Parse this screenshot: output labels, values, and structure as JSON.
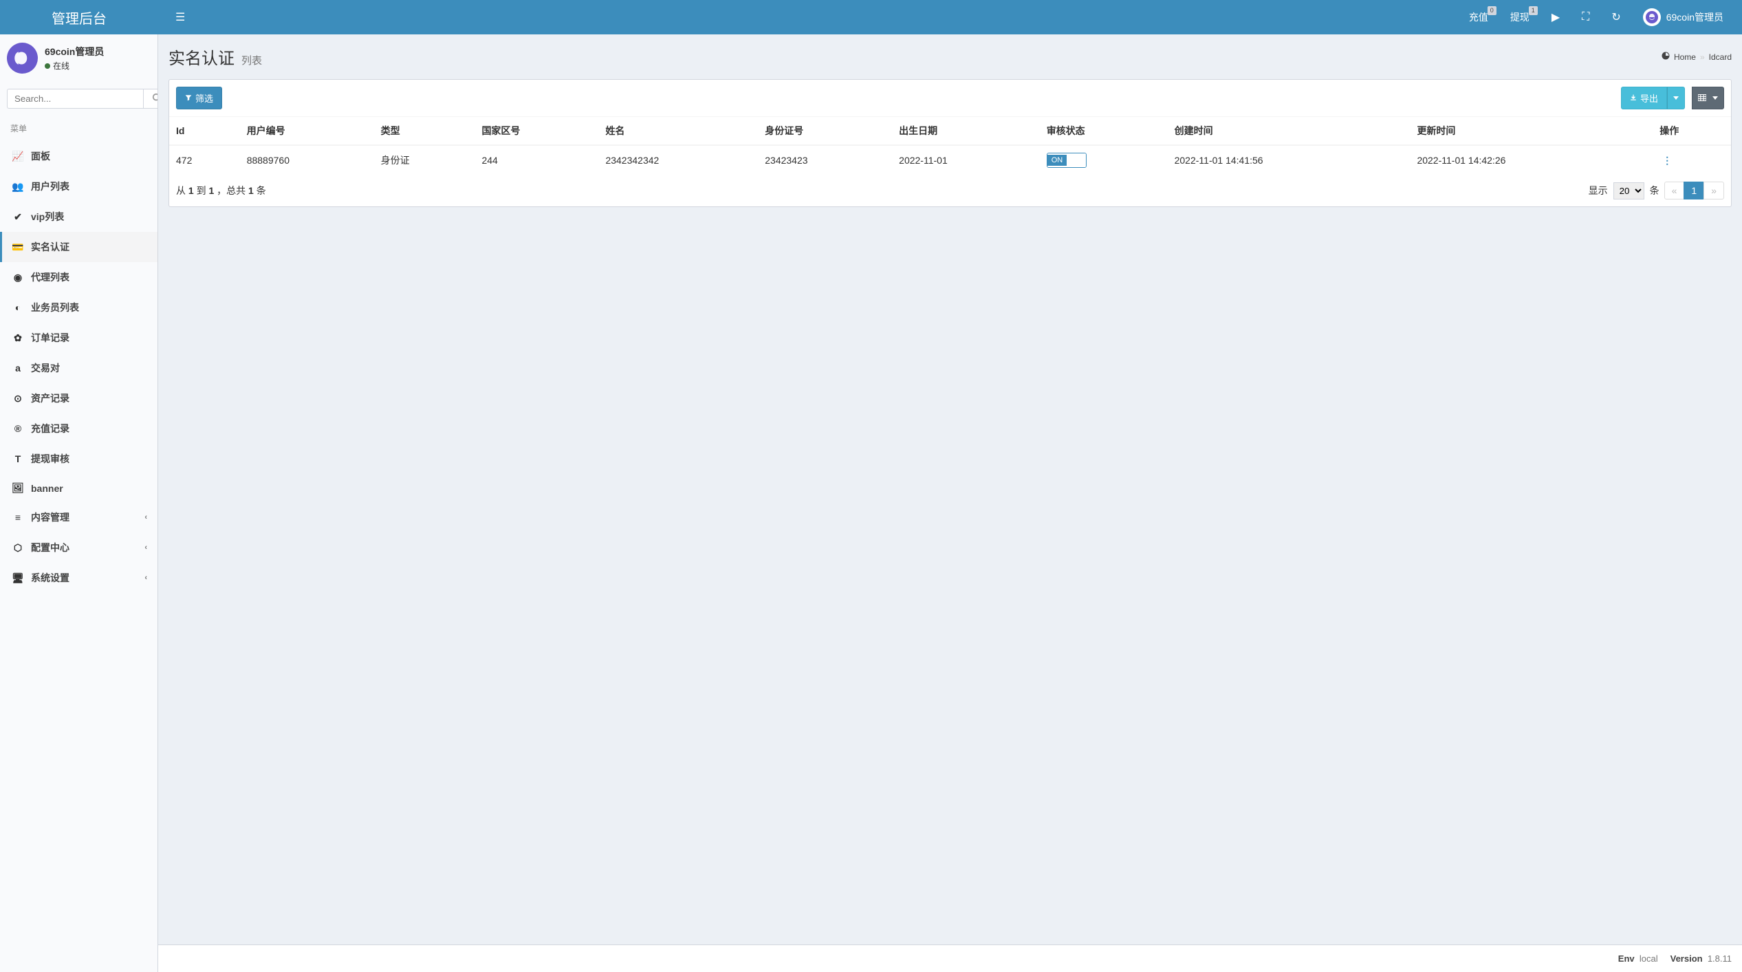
{
  "header": {
    "logo": "管理后台",
    "recharge_label": "充值",
    "recharge_badge": "0",
    "withdraw_label": "提现",
    "withdraw_badge": "1",
    "username": "69coin管理员"
  },
  "sidebar": {
    "user_name": "69coin管理员",
    "user_status": "在线",
    "search_placeholder": "Search...",
    "menu_header": "菜单",
    "items": [
      {
        "icon": "📈",
        "label": "面板",
        "expand": false,
        "active": false
      },
      {
        "icon": "👥",
        "label": "用户列表",
        "expand": false,
        "active": false
      },
      {
        "icon": "✔",
        "label": "vip列表",
        "expand": false,
        "active": false
      },
      {
        "icon": "💳",
        "label": "实名认证",
        "expand": false,
        "active": true
      },
      {
        "icon": "◉",
        "label": "代理列表",
        "expand": false,
        "active": false
      },
      {
        "icon": "◐",
        "label": "业务员列表",
        "expand": false,
        "active": false
      },
      {
        "icon": "✿",
        "label": "订单记录",
        "expand": false,
        "active": false
      },
      {
        "icon": "a",
        "label": "交易对",
        "expand": false,
        "active": false
      },
      {
        "icon": "⊙",
        "label": "资产记录",
        "expand": false,
        "active": false
      },
      {
        "icon": "®",
        "label": "充值记录",
        "expand": false,
        "active": false
      },
      {
        "icon": "T",
        "label": "提现审核",
        "expand": false,
        "active": false
      },
      {
        "icon": "🖼",
        "label": "banner",
        "expand": false,
        "active": false
      },
      {
        "icon": "≡",
        "label": "内容管理",
        "expand": true,
        "active": false
      },
      {
        "icon": "⬡",
        "label": "配置中心",
        "expand": true,
        "active": false
      },
      {
        "icon": "🖥",
        "label": "系统设置",
        "expand": true,
        "active": false
      }
    ]
  },
  "page": {
    "title": "实名认证",
    "subtitle": "列表",
    "breadcrumb_home": "Home",
    "breadcrumb_current": "Idcard"
  },
  "toolbar": {
    "filter_label": "筛选",
    "export_label": "导出"
  },
  "table": {
    "columns": [
      "Id",
      "用户编号",
      "类型",
      "国家区号",
      "姓名",
      "身份证号",
      "出生日期",
      "审核状态",
      "创建时间",
      "更新时间",
      "操作"
    ],
    "rows": [
      {
        "id": "472",
        "user_no": "88889760",
        "type": "身份证",
        "country_code": "244",
        "name": "2342342342",
        "id_number": "23423423",
        "birthdate": "2022-11-01",
        "status_on": "ON",
        "created_at": "2022-11-01 14:41:56",
        "updated_at": "2022-11-01 14:42:26"
      }
    ]
  },
  "pagination": {
    "summary_prefix": "从 ",
    "from": "1",
    "summary_mid1": " 到 ",
    "to": "1",
    "summary_mid2": " ，总共 ",
    "total": "1",
    "summary_suffix": " 条",
    "show_label": "显示",
    "per_page": "20",
    "unit": "条",
    "prev": "«",
    "current": "1",
    "next": "»"
  },
  "footer": {
    "env_label": "Env",
    "env_value": "local",
    "version_label": "Version",
    "version_value": "1.8.11"
  }
}
